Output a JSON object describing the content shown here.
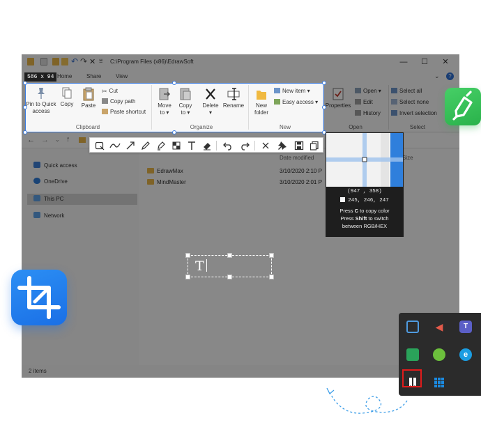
{
  "window": {
    "title_path": "C:\\Program Files (x86)\\EdrawSoft",
    "controls": {
      "minimize": "—",
      "maximize": "☐",
      "close": "✕"
    },
    "tabs": [
      "Home",
      "Share",
      "View"
    ]
  },
  "ribbon": {
    "clipboard": {
      "pin_label_1": "Pin to Quick",
      "pin_label_2": "access",
      "copy": "Copy",
      "paste": "Paste",
      "cut": "Cut",
      "copy_path": "Copy path",
      "paste_shortcut": "Paste shortcut",
      "group": "Clipboard"
    },
    "organize": {
      "move_to_1": "Move",
      "move_to_2": "to ▾",
      "copy_to_1": "Copy",
      "copy_to_2": "to ▾",
      "delete_1": "Delete",
      "delete_2": "▾",
      "rename": "Rename",
      "group": "Organize"
    },
    "new": {
      "new_folder_1": "New",
      "new_folder_2": "folder",
      "new_item": "New item ▾",
      "easy_access": "Easy access ▾",
      "group": "New"
    },
    "open": {
      "properties": "Properties",
      "open": "Open ▾",
      "edit": "Edit",
      "history": "History",
      "group": "Open"
    },
    "select": {
      "select_all": "Select all",
      "select_none": "Select none",
      "invert": "Invert selection",
      "group": "Select"
    }
  },
  "navigation": {
    "items": [
      "Quick access",
      "OneDrive",
      "This PC",
      "Network"
    ],
    "selected": "This PC"
  },
  "content": {
    "columns": [
      "Date modified",
      "Size"
    ],
    "files": [
      {
        "name": "EdrawMax",
        "modified": "3/10/2020 2:10 P"
      },
      {
        "name": "MindMaster",
        "modified": "3/10/2020 2:01 P"
      }
    ]
  },
  "status": {
    "items_count": "2 items"
  },
  "capture": {
    "size_badge": "586 x 94",
    "text_annotation": "T",
    "accent": "#3a7be0"
  },
  "toolbar": {
    "tools": [
      "rectangle-tool",
      "curve-tool",
      "arrow-tool",
      "pencil-tool",
      "marker-tool",
      "mosaic-tool",
      "text-tool",
      "eraser-tool",
      "undo",
      "redo",
      "cancel",
      "pin",
      "save",
      "copy"
    ]
  },
  "magnifier": {
    "coords": "(947 , 358)",
    "rgb": "245, 246, 247",
    "hint_1_a": "Press ",
    "hint_1_key": "C",
    "hint_1_b": " to copy color",
    "hint_2_a": "Press ",
    "hint_2_key": "Shift",
    "hint_2_b": " to switch",
    "hint_3": "between RGB/HEX"
  },
  "tray": {
    "icons": [
      "network-settings-icon",
      "volume-muted-icon",
      "teams-icon",
      "app-green-icon",
      "security-check-icon",
      "edge-sync-icon",
      "screenshot-app-icon",
      "grid-app-icon"
    ],
    "highlight_color": "#e11b1b"
  },
  "colors": {
    "crop_app": "#1a6fe6",
    "pen_app": "#2ab24b",
    "dim": "rgba(0,0,0,0.45)"
  }
}
